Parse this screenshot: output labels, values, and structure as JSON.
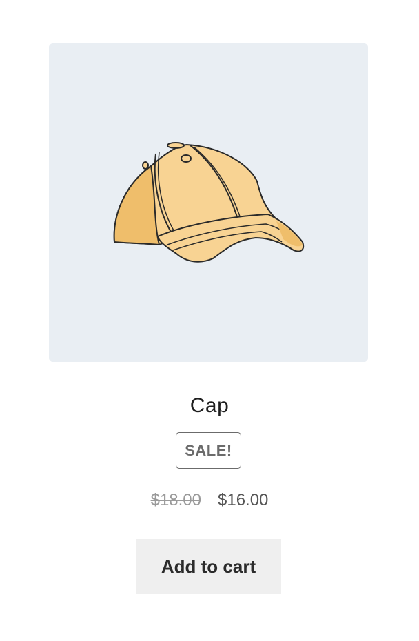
{
  "product": {
    "title": "Cap",
    "image_alt": "Cap",
    "sale_badge": "SALE!",
    "price_regular": "$18.00",
    "price_sale": "$16.00",
    "add_to_cart_label": "Add to cart"
  },
  "colors": {
    "image_background": "#e9eef3",
    "cap_fill": "#f8d393",
    "cap_shadow": "#efbe6b",
    "outline": "#2a2a2a",
    "button_background": "#efefef",
    "badge_border": "#6b6b6b"
  }
}
